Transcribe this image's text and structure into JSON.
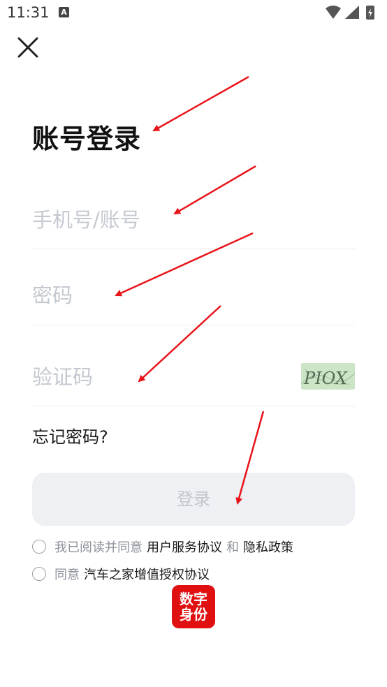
{
  "status_bar": {
    "time": "11:31",
    "notification_icon": "A"
  },
  "header": {
    "close_icon": "close-icon"
  },
  "page_title": "账号登录",
  "form": {
    "account_placeholder": "手机号/账号",
    "password_placeholder": "密码",
    "captcha_placeholder": "验证码",
    "captcha_text": "PIOX",
    "forgot_password": "忘记密码?"
  },
  "login_button": "登录",
  "agreements": {
    "line1_prefix": "我已阅读并同意",
    "user_agreement": "用户服务协议",
    "and": "和",
    "privacy_policy": "隐私政策",
    "line2_prefix": "同意",
    "value_added_agreement": "汽车之家增值授权协议"
  },
  "digital_id_badge": "数字身份",
  "colors": {
    "annotation_arrow": "#e8141a",
    "badge_bg": "#e01010"
  }
}
